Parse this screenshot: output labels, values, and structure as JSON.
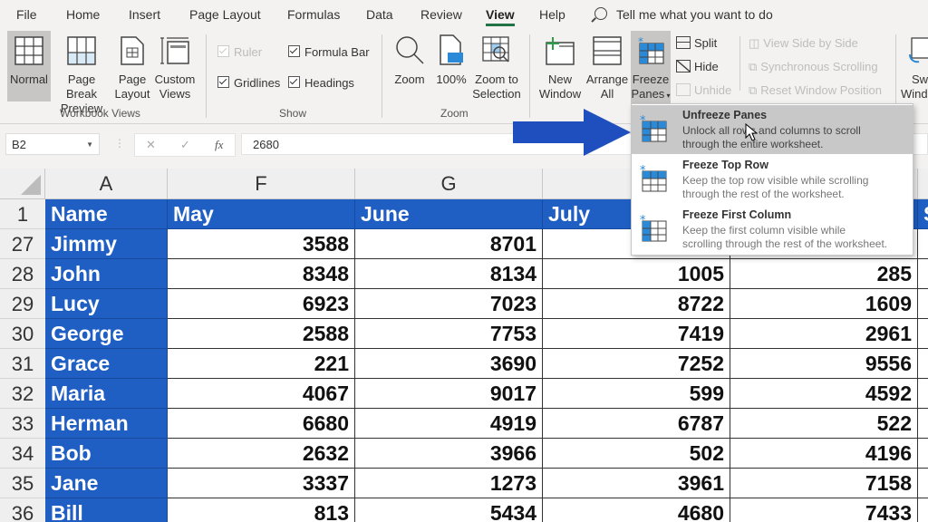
{
  "tabs": [
    "File",
    "Home",
    "Insert",
    "Page Layout",
    "Formulas",
    "Data",
    "Review",
    "View",
    "Help"
  ],
  "active_tab": "View",
  "tell_me": "Tell me what you want to do",
  "ribbon": {
    "workbook_views": {
      "label": "Workbook Views",
      "buttons": [
        {
          "line1": "Normal",
          "line2": "",
          "icon": "normal-view-icon",
          "selected": true
        },
        {
          "line1": "Page Break",
          "line2": "Preview",
          "icon": "page-break-preview-icon"
        },
        {
          "line1": "Page",
          "line2": "Layout",
          "icon": "page-layout-icon"
        },
        {
          "line1": "Custom",
          "line2": "Views",
          "icon": "custom-views-icon"
        }
      ]
    },
    "show": {
      "label": "Show",
      "ruler": {
        "label": "Ruler",
        "checked": true,
        "disabled": true
      },
      "formula_bar": {
        "label": "Formula Bar",
        "checked": true
      },
      "gridlines": {
        "label": "Gridlines",
        "checked": true
      },
      "headings": {
        "label": "Headings",
        "checked": true
      }
    },
    "zoom": {
      "label": "Zoom",
      "zoom": "Zoom",
      "hundred": "100%",
      "zoom_sel_1": "Zoom to",
      "zoom_sel_2": "Selection"
    },
    "window": {
      "new_window_1": "New",
      "new_window_2": "Window",
      "arrange_1": "Arrange",
      "arrange_2": "All",
      "freeze_1": "Freeze",
      "freeze_2": "Panes",
      "split": "Split",
      "hide": "Hide",
      "unhide": "Unhide",
      "side_by_side": "View Side by Side",
      "sync_scroll": "Synchronous Scrolling",
      "reset_pos": "Reset Window Position",
      "switch_1": "Sw",
      "switch_2": "Wind"
    }
  },
  "formula_bar": {
    "name_box": "B2",
    "cancel": "✕",
    "enter": "✓",
    "fx": "fx",
    "value": "2680"
  },
  "sheet": {
    "columns": [
      "A",
      "F",
      "G",
      "",
      ""
    ],
    "header_row": {
      "num": "1",
      "cells": [
        "Name",
        "May",
        "June",
        "July",
        "",
        "S"
      ]
    },
    "rows": [
      {
        "num": "27",
        "name": "Jimmy",
        "values": [
          "3588",
          "8701",
          "",
          "5"
        ]
      },
      {
        "num": "28",
        "name": "John",
        "values": [
          "8348",
          "8134",
          "1005",
          "285"
        ]
      },
      {
        "num": "29",
        "name": "Lucy",
        "values": [
          "6923",
          "7023",
          "8722",
          "1609"
        ]
      },
      {
        "num": "30",
        "name": "George",
        "values": [
          "2588",
          "7753",
          "7419",
          "2961"
        ]
      },
      {
        "num": "31",
        "name": "Grace",
        "values": [
          "221",
          "3690",
          "7252",
          "9556"
        ]
      },
      {
        "num": "32",
        "name": "Maria",
        "values": [
          "4067",
          "9017",
          "599",
          "4592"
        ]
      },
      {
        "num": "33",
        "name": "Herman",
        "values": [
          "6680",
          "4919",
          "6787",
          "522"
        ]
      },
      {
        "num": "34",
        "name": "Bob",
        "values": [
          "2632",
          "3966",
          "502",
          "4196"
        ]
      },
      {
        "num": "35",
        "name": "Jane",
        "values": [
          "3337",
          "1273",
          "3961",
          "7158"
        ]
      },
      {
        "num": "36",
        "name": "Bill",
        "values": [
          "813",
          "5434",
          "4680",
          "7433"
        ]
      }
    ]
  },
  "freeze_menu": {
    "items": [
      {
        "title": "Unfreeze Panes",
        "desc1": "Unlock all rows and columns to scroll",
        "desc2": "through the entire worksheet.",
        "highlighted": true
      },
      {
        "title": "Freeze Top Row",
        "desc1": "Keep the top row visible while scrolling",
        "desc2": "through the rest of the worksheet."
      },
      {
        "title": "Freeze First Column",
        "desc1": "Keep the first column visible while",
        "desc2": "scrolling through the rest of the worksheet."
      }
    ]
  },
  "colors": {
    "accent_green": "#217346",
    "table_blue": "#1f5fc4",
    "arrow_blue": "#1f4fbf"
  }
}
